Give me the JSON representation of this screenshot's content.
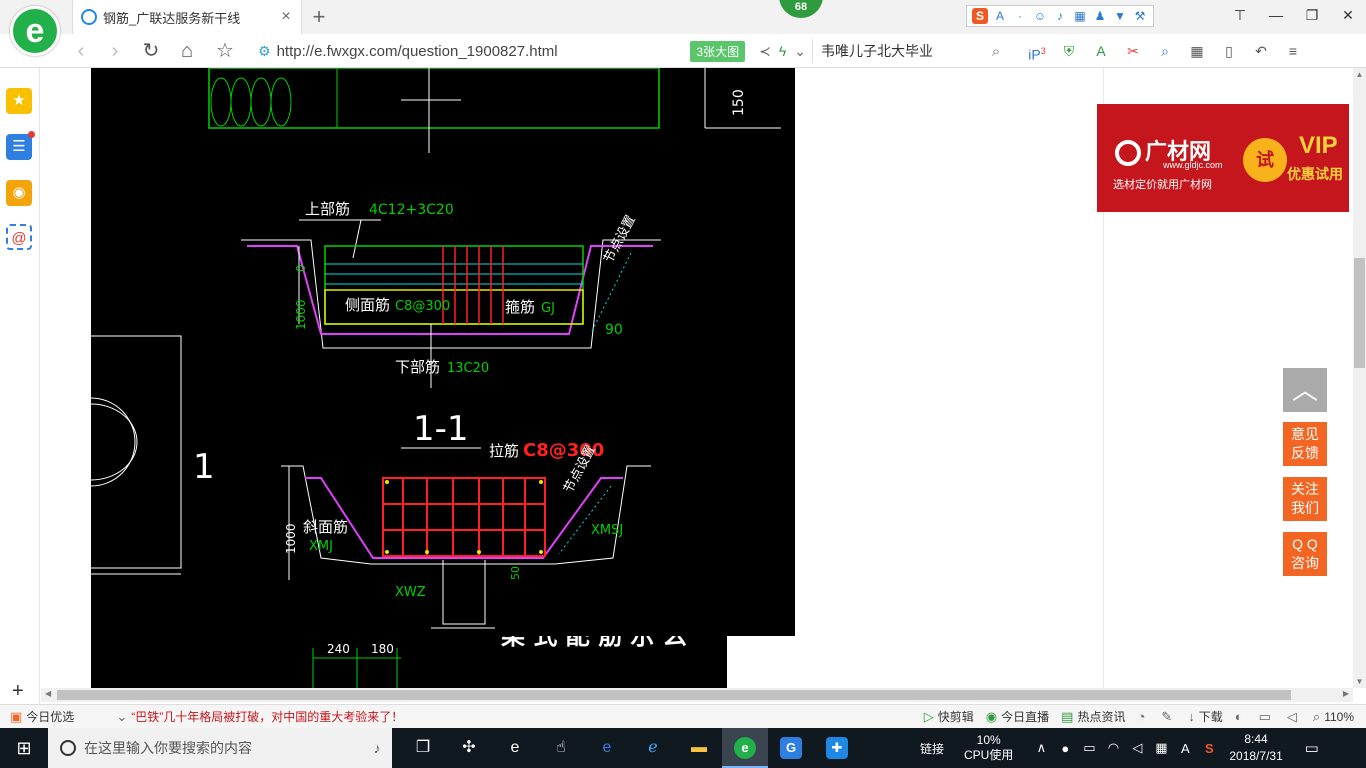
{
  "browser": {
    "tab_title": "钢筋_广联达服务新干线",
    "tab_close": "×",
    "new_tab": "+",
    "badge": "68",
    "url": "http://e.fwxgx.com/question_1900827.html",
    "big_image_button": "3张大图",
    "search_text": "韦唯儿子北大毕业",
    "ext_badge_count": "3"
  },
  "cad": {
    "top_dim": "150",
    "section1": {
      "top_bar_label": "上部筋",
      "top_bar_value": "4C12+3C20",
      "side_bar_label": "侧面筋",
      "side_bar_value": "C8@300",
      "stirrup_label": "箍筋",
      "stirrup_value": "GJ",
      "bottom_bar_label": "下部筋",
      "bottom_bar_value": "13C20",
      "node_label": "节点设置",
      "angle": "90",
      "dim_zero": "0",
      "dim_height": "1000",
      "section_title": "1-1",
      "left_mark": "1"
    },
    "section2": {
      "tie_label": "拉筋",
      "tie_value": "C8@300",
      "node_label": "节点设置",
      "slope_bar_label": "斜面筋",
      "slope_bar_value": "XMJ",
      "xmsj": "XMSJ",
      "xwz": "XWZ",
      "dim_height": "1000",
      "dim_50": "50"
    },
    "bottom_dims": [
      "240",
      "180"
    ],
    "cut_heading": "梁 式 配 筋 示 么"
  },
  "ad": {
    "logo": "广材网",
    "url": "www.gldjc.com",
    "slogan": "选材定价就用广材网",
    "try": "试",
    "vip": "VIP",
    "vip_sub": "优惠试用"
  },
  "float": {
    "to_top": "︿",
    "feedback": [
      "意见",
      "反馈"
    ],
    "follow": [
      "关注",
      "我们"
    ],
    "qq": [
      "Q Q",
      "咨询"
    ]
  },
  "statusbar": {
    "today_pick": "今日优选",
    "headline": "“巴铁”几十年格局被打破，对中国的重大考验来了！",
    "quick_edit": "快剪辑",
    "today_live": "今日直播",
    "hot_news": "热点资讯",
    "download": "下载",
    "zoom": "110%"
  },
  "taskbar": {
    "search_placeholder": "在这里输入你要搜索的内容",
    "links": "链接",
    "cpu_percent": "10%",
    "cpu_label": "CPU使用",
    "ime": "A",
    "time": "8:44",
    "date": "2018/7/31"
  },
  "colors": {
    "accent_green": "#22b04a",
    "float_orange": "#f26522",
    "ad_red": "#c4161c",
    "cad_green": "#00d000",
    "cad_red": "#ff2020",
    "cad_magenta": "#e040fb"
  }
}
